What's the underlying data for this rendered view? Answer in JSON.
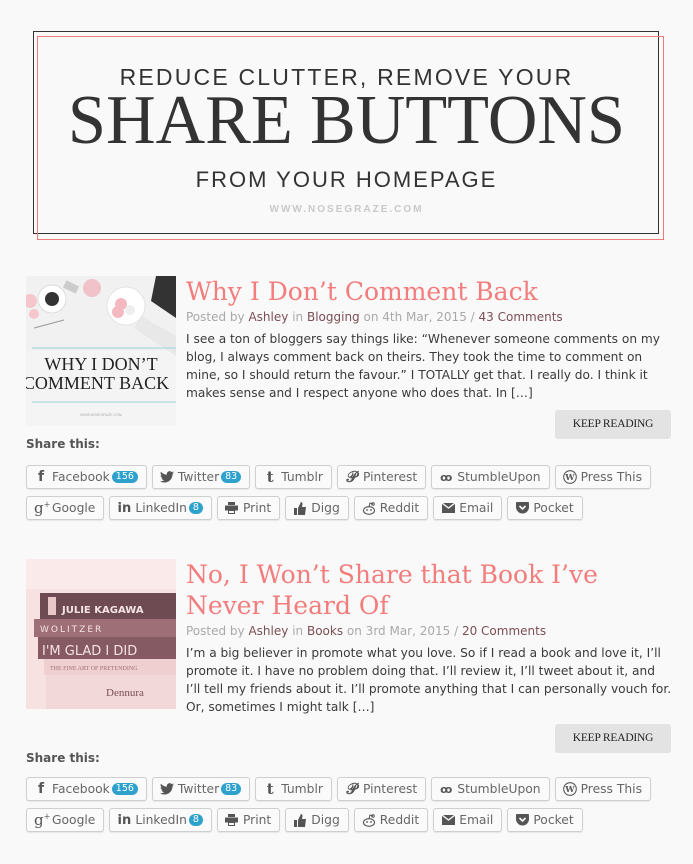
{
  "banner": {
    "line1": "REDUCE CLUTTER, REMOVE YOUR",
    "line2": "SHARE BUTTONS",
    "line3": "FROM YOUR HOMEPAGE",
    "url": "WWW.NOSEGRAZE.COM"
  },
  "colors": {
    "title": "#f37c7c",
    "meta_link": "#7a4f55",
    "badge": "#2ea2cc",
    "banner_pink_frame": "#f07a7a"
  },
  "posts": [
    {
      "title": "Why I Don’t Comment Back",
      "thumb": {
        "line1": "WHY I DON’T",
        "line2": "COMMENT BACK",
        "caption": "WWW.NOSEGRAZE.COM"
      },
      "meta": {
        "posted_by": "Posted by",
        "author": "Ashley",
        "in": "in",
        "category": "Blogging",
        "on": "on 4th Mar, 2015 /",
        "comments": "43 Comments"
      },
      "excerpt": "I see a ton of bloggers say things like: “Whenever someone comments on my blog, I always comment back on theirs. They took the time to comment on mine, so I should return the favour.” I TOTALLY get that. I really do. I think it makes sense and I respect anyone who does that. In […]",
      "keep_reading": "KEEP READING",
      "share_label": "Share this:"
    },
    {
      "title": "No, I Won’t Share that Book I’ve Never Heard Of",
      "thumb": {
        "books": [
          "JULIE KAGAWA",
          "WOLITZER",
          "I'M GLAD I DID",
          "THE FINE ART OF PRETENDING",
          "Dennura"
        ]
      },
      "meta": {
        "posted_by": "Posted by",
        "author": "Ashley",
        "in": "in",
        "category": "Books",
        "on": "on 3rd Mar, 2015 /",
        "comments": "20 Comments"
      },
      "excerpt": "I’m a big believer in promote what you love. So if I read a book and love it, I’ll promote it. I have no problem doing that. I’ll review it, I’ll tweet about it, and I’ll tell my friends about it. I’ll promote anything that I can personally vouch for. Or, sometimes I might talk […]",
      "keep_reading": "KEEP READING",
      "share_label": "Share this:"
    }
  ],
  "share_buttons": {
    "row1": [
      {
        "label": "Facebook",
        "icon": "facebook-icon",
        "count": "156"
      },
      {
        "label": "Twitter",
        "icon": "twitter-icon",
        "count": "83"
      },
      {
        "label": "Tumblr",
        "icon": "tumblr-icon"
      },
      {
        "label": "Pinterest",
        "icon": "pinterest-icon"
      },
      {
        "label": "StumbleUpon",
        "icon": "stumbleupon-icon"
      },
      {
        "label": "Press This",
        "icon": "wordpress-icon"
      }
    ],
    "row2": [
      {
        "label": "Google",
        "icon": "google-plus-icon"
      },
      {
        "label": "LinkedIn",
        "icon": "linkedin-icon",
        "count": "8"
      },
      {
        "label": "Print",
        "icon": "print-icon"
      },
      {
        "label": "Digg",
        "icon": "thumbs-up-icon"
      },
      {
        "label": "Reddit",
        "icon": "reddit-icon"
      },
      {
        "label": "Email",
        "icon": "email-icon"
      },
      {
        "label": "Pocket",
        "icon": "pocket-icon"
      }
    ]
  }
}
